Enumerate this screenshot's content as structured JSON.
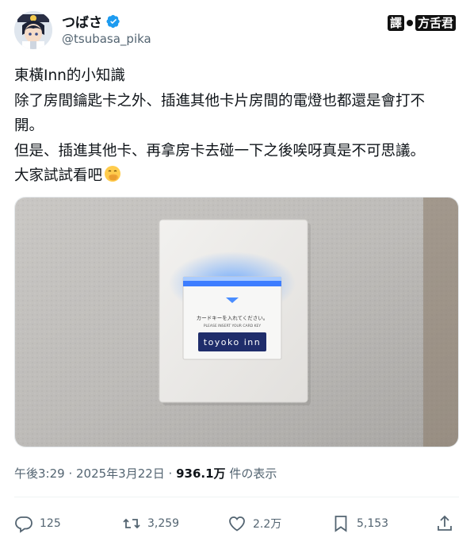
{
  "author": {
    "display_name": "つばさ",
    "handle": "@tsubasa_pika",
    "verified_icon": "verified-badge-icon"
  },
  "watermark": {
    "left_text": "譯",
    "right_text": "方舌君"
  },
  "post": {
    "lines": [
      "東橫Inn的小知識",
      "除了房間鑰匙卡之外、插進其他卡片房間的電燈也都還是會打不",
      "開。",
      "但是、插進其他卡、再拿房卡去碰一下之後唉呀真是不可思議。",
      "大家試試看吧"
    ],
    "emoji": "face-with-hand-over-mouth-icon"
  },
  "photo": {
    "card_slot_text_ja": "カードキーを入れてください。",
    "card_slot_text_en": "PLEASE INSERT YOUR CARD KEY",
    "card_logo": "toyoko inn"
  },
  "meta": {
    "time": "午後3:29 · 2025年3月22日 · ",
    "views": "936.1万",
    "views_suffix": " 件の表示"
  },
  "actions": {
    "reply_count": "125",
    "repost_count": "3,259",
    "like_count": "2.2万",
    "bookmark_count": "5,153"
  },
  "colors": {
    "accent": "#1d9bf0",
    "secondary_text": "#536471",
    "slot_glow": "#2f7dff"
  }
}
